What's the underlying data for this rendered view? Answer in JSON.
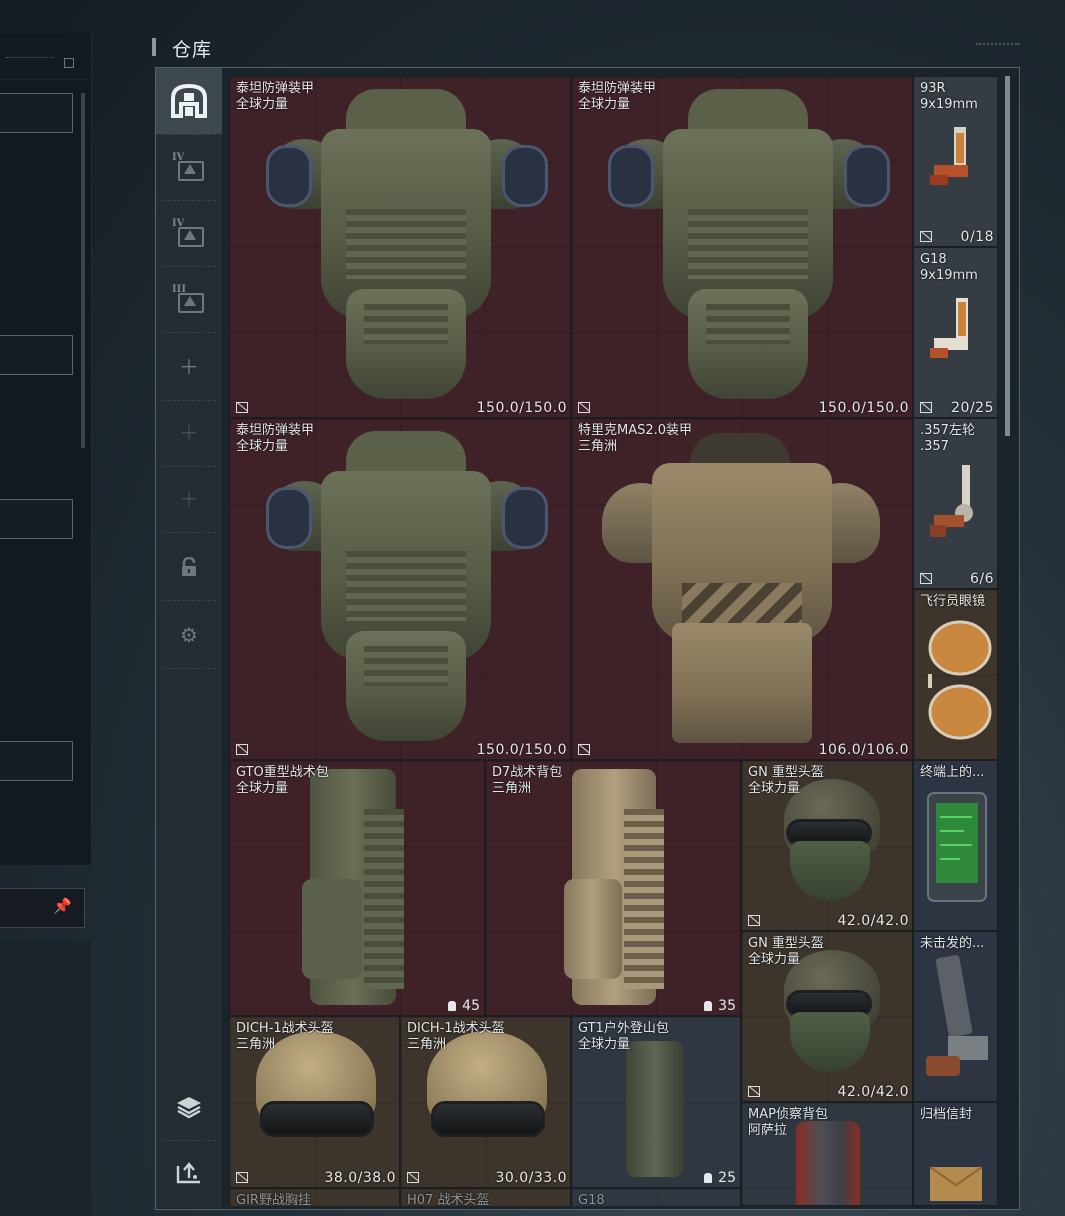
{
  "window": {
    "title": "仓库"
  },
  "rail": {
    "items": [
      {
        "name": "home",
        "icon": "storage-home-icon"
      },
      {
        "name": "tier4-a",
        "icon": "tier-iv-case-icon",
        "roman": "IV"
      },
      {
        "name": "tier4-b",
        "icon": "tier-iv-case-icon",
        "roman": "IV"
      },
      {
        "name": "tier3",
        "icon": "tier-iii-case-icon",
        "roman": "III"
      },
      {
        "name": "add-1",
        "icon": "plus-icon"
      },
      {
        "name": "add-2",
        "icon": "plus-icon"
      },
      {
        "name": "add-3",
        "icon": "plus-icon"
      },
      {
        "name": "lock",
        "icon": "lock-icon"
      },
      {
        "name": "settings",
        "icon": "gear-icon"
      },
      {
        "name": "layers",
        "icon": "layers-icon"
      },
      {
        "name": "transfer",
        "icon": "transfer-icon"
      }
    ]
  },
  "items": {
    "vest1": {
      "name": "泰坦防弹装甲",
      "sub": "全球力量",
      "dur": "150.0/150.0"
    },
    "vest2": {
      "name": "泰坦防弹装甲",
      "sub": "全球力量",
      "dur": "150.0/150.0"
    },
    "vest3": {
      "name": "泰坦防弹装甲",
      "sub": "全球力量",
      "dur": "150.0/150.0"
    },
    "vest4": {
      "name": "特里克MAS2.0装甲",
      "sub": "三角洲",
      "dur": "106.0/106.0"
    },
    "gun1": {
      "name": "93R",
      "sub": "9x19mm",
      "dur": "0/18"
    },
    "gun2": {
      "name": "G18",
      "sub": "9x19mm",
      "dur": "20/25"
    },
    "gun3": {
      "name": ".357左轮",
      "sub": ".357",
      "dur": "6/6"
    },
    "glasses": {
      "name": "飞行员眼镜"
    },
    "bag1": {
      "name": "GTO重型战术包",
      "sub": "全球力量",
      "cap": "45"
    },
    "bag2": {
      "name": "D7战术背包",
      "sub": "三角洲",
      "cap": "35"
    },
    "helm1": {
      "name": "GN 重型头盔",
      "sub": "全球力量",
      "dur": "42.0/42.0"
    },
    "helm2": {
      "name": "GN 重型头盔",
      "sub": "全球力量",
      "dur": "42.0/42.0"
    },
    "terminal": {
      "name": "终端上的..."
    },
    "unfired": {
      "name": "未击发的..."
    },
    "dich1": {
      "name": "DICH-1战术头盔",
      "sub": "三角洲",
      "dur": "38.0/38.0"
    },
    "dich2": {
      "name": "DICH-1战术头盔",
      "sub": "三角洲",
      "dur": "30.0/33.0"
    },
    "gt1": {
      "name": "GT1户外登山包",
      "sub": "全球力量",
      "cap": "25"
    },
    "map": {
      "name": "MAP侦察背包",
      "sub": "阿萨拉"
    },
    "archive": {
      "name": "归档信封"
    },
    "gir": {
      "name": "GIR野战胸挂"
    },
    "h07": {
      "name": "H07 战术头盔"
    },
    "g18b": {
      "name": "G18"
    }
  },
  "colors": {
    "high_tier": "#3f2228",
    "mid_tier": "#3d342b",
    "low_tier": "#2f3741",
    "text": "#e4e8ea"
  }
}
